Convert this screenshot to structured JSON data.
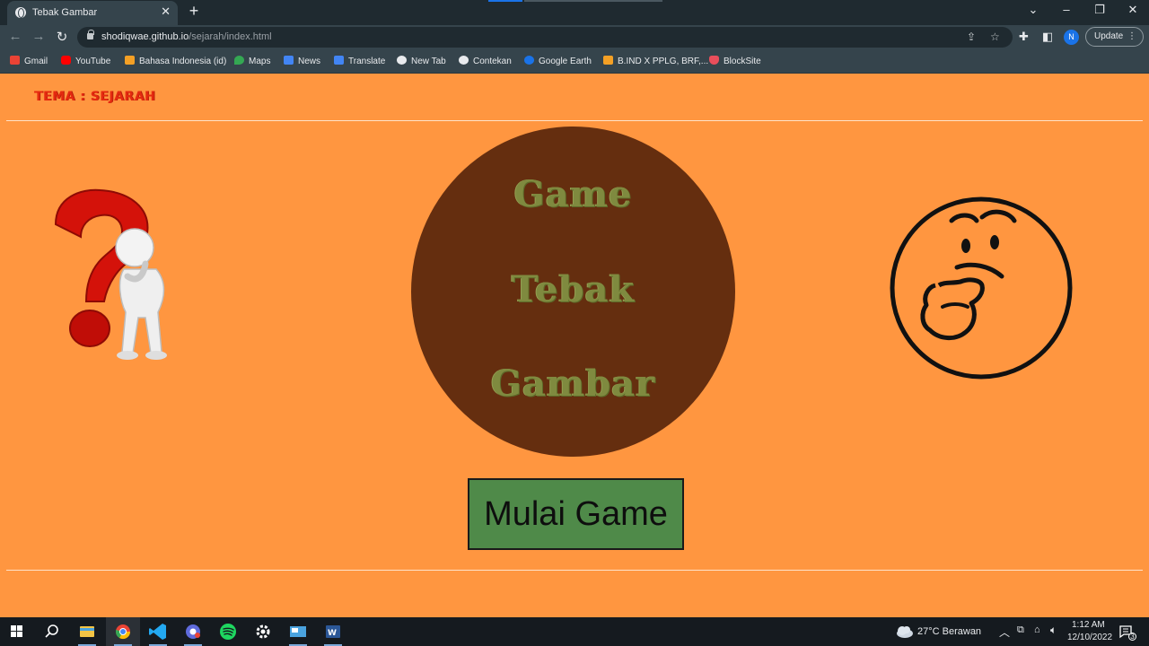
{
  "browser": {
    "tab_title": "Tebak Gambar",
    "url_host": "shodiqwae.github.io",
    "url_path": "/sejarah/index.html",
    "profile_initial": "N",
    "update_label": "Update",
    "bookmarks": [
      {
        "label": "Gmail",
        "color": "#ea4335"
      },
      {
        "label": "YouTube",
        "color": "#ff0000"
      },
      {
        "label": "Bahasa Indonesia (id)",
        "color": "#f4a025"
      },
      {
        "label": "Maps",
        "color": "#34a853"
      },
      {
        "label": "News",
        "color": "#4285f4"
      },
      {
        "label": "Translate",
        "color": "#4285f4"
      },
      {
        "label": "New Tab",
        "color": "#e8eaed"
      },
      {
        "label": "Contekan",
        "color": "#e8eaed"
      },
      {
        "label": "Google Earth",
        "color": "#1a73e8"
      },
      {
        "label": "B.IND X PPLG, BRF,...",
        "color": "#f4a025"
      },
      {
        "label": "BlockSite",
        "color": "#e94e5b"
      }
    ]
  },
  "page": {
    "theme_label": "TEMA : SEJARAH",
    "title_words": [
      "Game",
      "Tebak",
      "Gambar"
    ],
    "start_button": "Mulai Game",
    "colors": {
      "background": "#ff9640",
      "circle": "#652e0f",
      "button": "#4f8a49",
      "theme": "#e52a10"
    }
  },
  "taskbar": {
    "weather": "27°C  Berawan",
    "time": "1:12 AM",
    "date": "12/10/2022",
    "notifications": "3",
    "apps": [
      "start-icon",
      "search-icon",
      "file-explorer-icon",
      "chrome-icon",
      "vscode-icon",
      "chrome-app-icon",
      "spotify-icon",
      "settings-icon",
      "control-panel-icon",
      "word-icon"
    ]
  }
}
